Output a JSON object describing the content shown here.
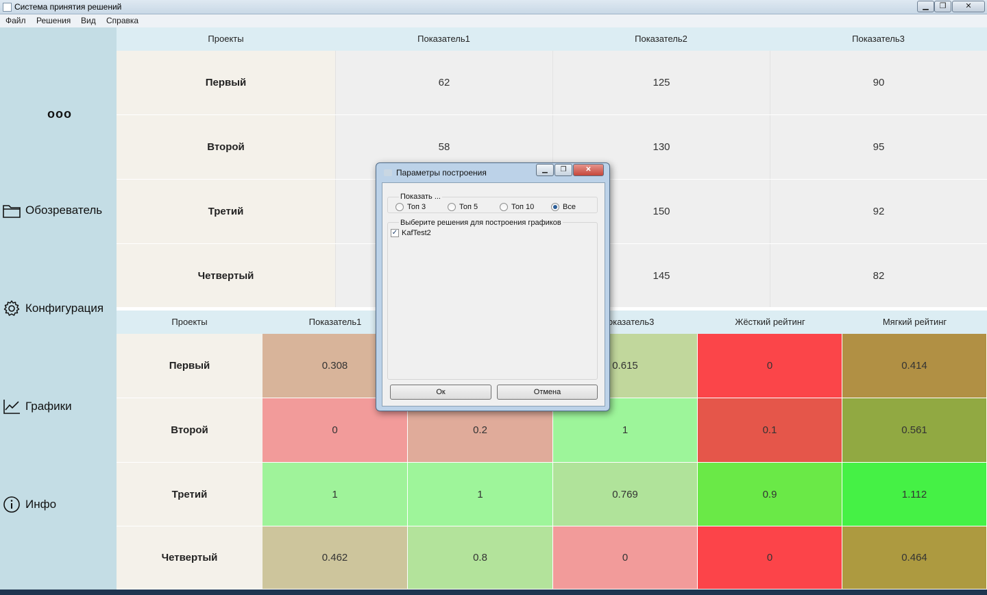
{
  "window": {
    "title": "Система принятия решений",
    "controls": {
      "min": "▁",
      "max": "❐",
      "close": "✕"
    }
  },
  "menu": {
    "items": [
      "Файл",
      "Решения",
      "Вид",
      "Справка"
    ]
  },
  "sidebar": {
    "more": "ooo",
    "items": [
      {
        "label": "Обозреватель",
        "icon": "folder-icon"
      },
      {
        "label": "Конфигурация",
        "icon": "gear-icon"
      },
      {
        "label": "Графики",
        "icon": "chart-icon"
      },
      {
        "label": "Инфо",
        "icon": "info-icon"
      }
    ]
  },
  "table1": {
    "headers": [
      "Проекты",
      "Показатель1",
      "Показатель2",
      "Показатель3"
    ],
    "rows": [
      {
        "name": "Первый",
        "values": [
          "62",
          "125",
          "90"
        ]
      },
      {
        "name": "Второй",
        "values": [
          "58",
          "130",
          "95"
        ]
      },
      {
        "name": "Третий",
        "values": [
          "",
          "150",
          "92"
        ]
      },
      {
        "name": "Четвертый",
        "values": [
          "",
          "145",
          "82"
        ]
      }
    ]
  },
  "table2": {
    "headers": [
      "Проекты",
      "Показатель1",
      "",
      "оказатель3",
      "Жёсткий рейтинг",
      "Мягкий рейтинг"
    ],
    "rows": [
      {
        "name": "Первый",
        "values": [
          "0.308",
          "",
          "0.615",
          "0",
          "0.414"
        ]
      },
      {
        "name": "Второй",
        "values": [
          "0",
          "0.2",
          "1",
          "0.1",
          "0.561"
        ]
      },
      {
        "name": "Третий",
        "values": [
          "1",
          "1",
          "0.769",
          "0.9",
          "1.112"
        ]
      },
      {
        "name": "Четвертый",
        "values": [
          "0.462",
          "0.8",
          "0",
          "0",
          "0.464"
        ]
      }
    ],
    "colors": [
      [
        "#d8b49a",
        "#d8b49a",
        "#c1d79c",
        "#fb4549",
        "#b19044"
      ],
      [
        "#f29b9a",
        "#e0ab9a",
        "#9df59a",
        "#e5564a",
        "#91a942"
      ],
      [
        "#9ff39a",
        "#9ef59a",
        "#b0e39a",
        "#6ae947",
        "#45f145"
      ],
      [
        "#cdc59c",
        "#b3e39b",
        "#f29b9a",
        "#fc4449",
        "#ad9a40"
      ]
    ]
  },
  "dialog": {
    "title": "Параметры построения",
    "show_group": "Показать ...",
    "radios": [
      {
        "label": "Топ 3",
        "checked": false
      },
      {
        "label": "Топ 5",
        "checked": false
      },
      {
        "label": "Топ 10",
        "checked": false
      },
      {
        "label": "Все",
        "checked": true
      }
    ],
    "select_group": "Выберите решения для построения графиков",
    "checkbox": {
      "label": "KafTest2",
      "checked": true
    },
    "ok": "Ок",
    "cancel": "Отмена"
  }
}
